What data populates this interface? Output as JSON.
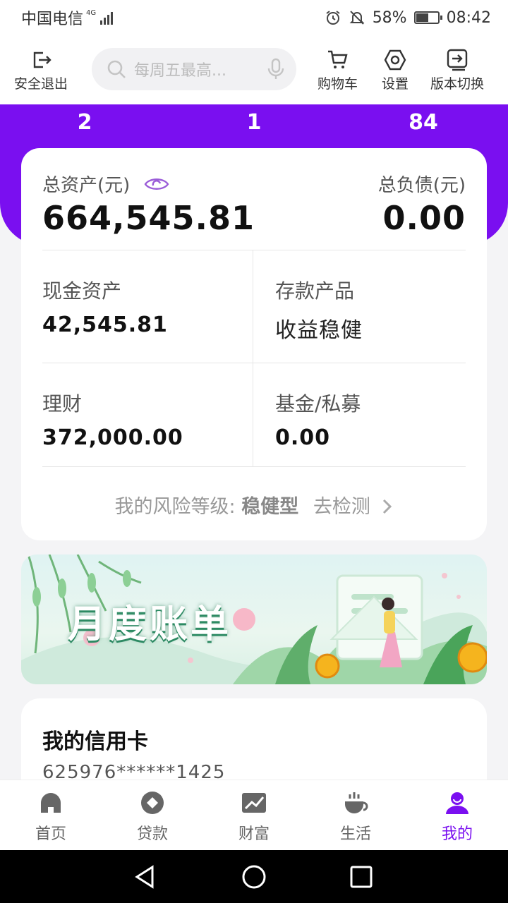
{
  "status_bar": {
    "carrier": "中国电信",
    "network": "4G",
    "battery": "58%",
    "battery_level": 0.58,
    "time": "08:42"
  },
  "header": {
    "logout_label": "安全退出",
    "search_placeholder": "每周五最高...",
    "cart_label": "购物车",
    "settings_label": "设置",
    "version_label": "版本切换"
  },
  "counts": [
    "2",
    "1",
    "84"
  ],
  "assets": {
    "total_assets_label": "总资产(元)",
    "total_assets_value": "664,545.81",
    "total_liabilities_label": "总负债(元)",
    "total_liabilities_value": "0.00",
    "items": [
      {
        "label": "现金资产",
        "value": "42,545.81"
      },
      {
        "label": "存款产品",
        "value": "收益稳健"
      },
      {
        "label": "理财",
        "value": "372,000.00"
      },
      {
        "label": "基金/私募",
        "value": "0.00"
      }
    ],
    "risk_prefix": "我的风险等级:",
    "risk_level": "稳健型",
    "risk_action": "去检测"
  },
  "banner": {
    "title": "月度账单"
  },
  "credit_card": {
    "title": "我的信用卡",
    "number": "625976******1425"
  },
  "tabs": [
    {
      "label": "首页",
      "icon": "home-icon"
    },
    {
      "label": "贷款",
      "icon": "loan-icon"
    },
    {
      "label": "财富",
      "icon": "wealth-icon"
    },
    {
      "label": "生活",
      "icon": "coffee-icon"
    },
    {
      "label": "我的",
      "icon": "user-icon",
      "active": true
    }
  ],
  "colors": {
    "primary": "#7a0ff0"
  }
}
